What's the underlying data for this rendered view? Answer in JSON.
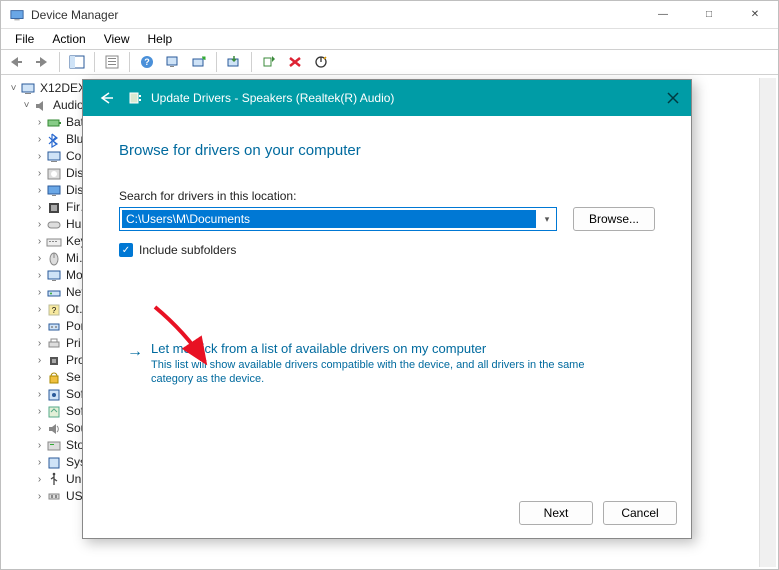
{
  "window": {
    "title": "Device Manager",
    "buttons": {
      "min": "—",
      "max": "□",
      "close": "✕"
    }
  },
  "menu": {
    "file": "File",
    "action": "Action",
    "view": "View",
    "help": "Help"
  },
  "tree": {
    "root": "X12DEX",
    "nodes": [
      {
        "lvl": 1,
        "tw": "v",
        "icon": "audio",
        "label": "Audio …"
      },
      {
        "lvl": 2,
        "tw": ">",
        "icon": "battery",
        "label": "Bat…"
      },
      {
        "lvl": 2,
        "tw": ">",
        "icon": "bluetooth",
        "label": "Blu…"
      },
      {
        "lvl": 2,
        "tw": ">",
        "icon": "computer",
        "label": "Co…"
      },
      {
        "lvl": 2,
        "tw": ">",
        "icon": "disk",
        "label": "Dis…"
      },
      {
        "lvl": 2,
        "tw": ">",
        "icon": "display",
        "label": "Dis…"
      },
      {
        "lvl": 2,
        "tw": ">",
        "icon": "firmware",
        "label": "Fir…"
      },
      {
        "lvl": 2,
        "tw": ">",
        "icon": "hid",
        "label": "Hu…"
      },
      {
        "lvl": 2,
        "tw": ">",
        "icon": "keyboard",
        "label": "Key…"
      },
      {
        "lvl": 2,
        "tw": ">",
        "icon": "mouse",
        "label": "Mi…"
      },
      {
        "lvl": 2,
        "tw": ">",
        "icon": "monitor",
        "label": "Mo…"
      },
      {
        "lvl": 2,
        "tw": ">",
        "icon": "network",
        "label": "Net…"
      },
      {
        "lvl": 2,
        "tw": ">",
        "icon": "other",
        "label": "Ot…"
      },
      {
        "lvl": 2,
        "tw": ">",
        "icon": "port",
        "label": "Por…"
      },
      {
        "lvl": 2,
        "tw": ">",
        "icon": "printer",
        "label": "Pri…"
      },
      {
        "lvl": 2,
        "tw": ">",
        "icon": "processor",
        "label": "Pro…"
      },
      {
        "lvl": 2,
        "tw": ">",
        "icon": "security",
        "label": "Se…"
      },
      {
        "lvl": 2,
        "tw": ">",
        "icon": "software-comp",
        "label": "Sof…"
      },
      {
        "lvl": 2,
        "tw": ">",
        "icon": "software-dev",
        "label": "Sof…"
      },
      {
        "lvl": 2,
        "tw": ">",
        "icon": "sound",
        "label": "Sou…"
      },
      {
        "lvl": 2,
        "tw": ">",
        "icon": "storage",
        "label": "Sto…"
      },
      {
        "lvl": 2,
        "tw": ">",
        "icon": "system",
        "label": "Sys…"
      },
      {
        "lvl": 2,
        "tw": ">",
        "icon": "usb",
        "label": "Uni…"
      },
      {
        "lvl": 2,
        "tw": ">",
        "icon": "usb-conn",
        "label": "USB Connector Managers"
      }
    ]
  },
  "modal": {
    "title": "Update Drivers - Speakers (Realtek(R) Audio)",
    "heading": "Browse for drivers on your computer",
    "searchLabel": "Search for drivers in this location:",
    "path": "C:\\Users\\M\\Documents",
    "browse": "Browse...",
    "includeSub": "Include subfolders",
    "pickTitle": "Let me pick from a list of available drivers on my computer",
    "pickDesc": "This list will show available drivers compatible with the device, and all drivers in the same category as the device.",
    "next": "Next",
    "cancel": "Cancel"
  }
}
